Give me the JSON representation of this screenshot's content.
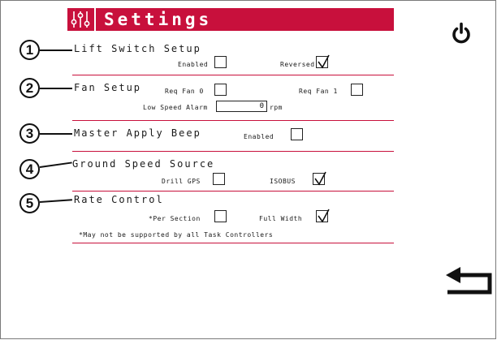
{
  "header": {
    "title": "Settings",
    "icon": "sliders-icon",
    "accent_color": "#c8103c"
  },
  "power_button": {
    "icon": "power-icon"
  },
  "back_button": {
    "icon": "back-arrow-icon"
  },
  "sections": {
    "lift_switch": {
      "number": "1",
      "title": "Lift Switch Setup",
      "enabled_label": "Enabled",
      "enabled_checked": false,
      "reversed_label": "Reversed",
      "reversed_checked": true
    },
    "fan": {
      "number": "2",
      "title": "Fan Setup",
      "req_fan_0_label": "Req Fan 0",
      "req_fan_0_checked": false,
      "req_fan_1_label": "Req Fan 1",
      "req_fan_1_checked": false,
      "low_speed_alarm_label": "Low Speed Alarm",
      "low_speed_alarm_value": "0",
      "low_speed_alarm_unit": "rpm"
    },
    "master_apply_beep": {
      "number": "3",
      "title": "Master Apply Beep",
      "enabled_label": "Enabled",
      "enabled_checked": false
    },
    "ground_speed": {
      "number": "4",
      "title": "Ground Speed Source",
      "drill_gps_label": "Drill GPS",
      "drill_gps_checked": false,
      "isobus_label": "ISOBUS",
      "isobus_checked": true
    },
    "rate_control": {
      "number": "5",
      "title": "Rate Control",
      "per_section_label": "*Per Section",
      "per_section_checked": false,
      "full_width_label": "Full Width",
      "full_width_checked": true,
      "footnote": "*May not be supported by all Task Controllers"
    }
  }
}
